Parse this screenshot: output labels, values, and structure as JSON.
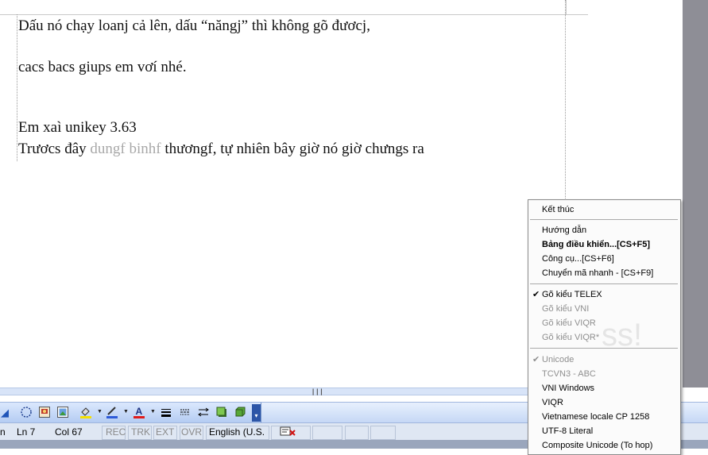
{
  "document": {
    "lines": [
      "Dấu nó chạy loanj cả lên, dấu “năngj” thì không gõ đươcj,",
      "cacs bacs giups em vơí nhé.",
      " Em xaì unikey 3.63",
      "Trươcs đây ",
      "dungf  binhf",
      " thươngf, tự nhiên bây giờ nó giờ chưngs ra"
    ]
  },
  "status": {
    "page": "n",
    "ln": "Ln 7",
    "col": "Col 67",
    "rec": "REC",
    "trk": "TRK",
    "ext": "EXT",
    "ovr": "OVR",
    "lang": "English (U.S."
  },
  "menu": {
    "items": [
      {
        "label": "Kết thúc",
        "state": "normal"
      },
      {
        "label": "Hướng dẫn",
        "state": "normal"
      },
      {
        "label": "Bảng điều khiển...[CS+F5]",
        "state": "bold"
      },
      {
        "label": "Công cụ...[CS+F6]",
        "state": "normal"
      },
      {
        "label": "Chuyển mã nhanh - [CS+F9]",
        "state": "normal"
      },
      {
        "label": "Gõ kiểu TELEX",
        "state": "checked"
      },
      {
        "label": "Gõ kiểu VNI",
        "state": "disabled"
      },
      {
        "label": "Gõ kiểu VIQR",
        "state": "disabled"
      },
      {
        "label": "Gõ kiểu VIQR*",
        "state": "disabled"
      },
      {
        "label": "Unicode",
        "state": "disabled-checked"
      },
      {
        "label": "TCVN3 - ABC",
        "state": "disabled"
      },
      {
        "label": "VNI Windows",
        "state": "normal"
      },
      {
        "label": "VIQR",
        "state": "normal"
      },
      {
        "label": "Vietnamese locale CP 1258",
        "state": "normal"
      },
      {
        "label": "UTF-8 Literal",
        "state": "normal"
      },
      {
        "label": "Composite Unicode (To hop)",
        "state": "normal"
      }
    ],
    "check_glyph": "✔"
  },
  "toolbar": {
    "icons": [
      "align-icon",
      "shapes-icon",
      "picture-icon",
      "clipart-icon",
      "fill-color-icon",
      "line-color-icon",
      "font-color-icon",
      "line-style-icon",
      "dash-style-icon",
      "arrow-style-icon",
      "shadow-icon",
      "3d-icon",
      "toolbar-options-icon"
    ],
    "font_color_glyph": "A"
  },
  "colors": {
    "fill_color": "#f5e000",
    "line_color": "#2e5bd8",
    "font_color": "#e01b1b"
  }
}
